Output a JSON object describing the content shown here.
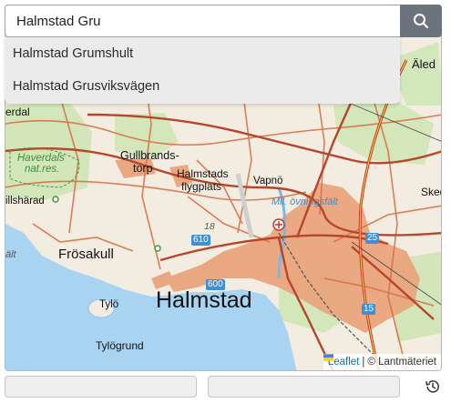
{
  "search": {
    "value": "Halmstad Gru",
    "button_icon": "search-icon"
  },
  "suggestions": [
    "Halmstad Grumshult",
    "Halmstad Grusviksvägen"
  ],
  "map": {
    "labels": {
      "city": "Halmstad",
      "gullbrandstorp_1": "Gullbrands-",
      "gullbrandstorp_2": "torp",
      "flygplats_1": "Halmstads",
      "flygplats_2": "flygplats",
      "vapno": "Vapnö",
      "ovningsfalt": "Mll. övningsfält",
      "haverdals_1": "Haverdals",
      "haverdals_2": "nat.res.",
      "frosakull": "Frösakull",
      "tylo": "Tylö",
      "tylogrund": "Tylögrund",
      "skedala": "Skedala",
      "aled": "Äled",
      "illsharad": "illshärad",
      "alt": "ält",
      "erdal": "erdal",
      "route_610": "610",
      "route_600": "600",
      "route_25": "25",
      "route_15": "15",
      "number_18": "18"
    },
    "colors": {
      "water": "#a8d4f0",
      "land": "#f3ede1",
      "urban": "#e8a57c",
      "road_major": "#b4452b",
      "road_minor": "#d9704a",
      "forest": "#bfdda0"
    }
  },
  "attribution": {
    "leaflet": "Leaflet",
    "separator": "|",
    "copyright": "© Lantmäteriet"
  },
  "footer": {
    "history_icon": "history-icon"
  }
}
